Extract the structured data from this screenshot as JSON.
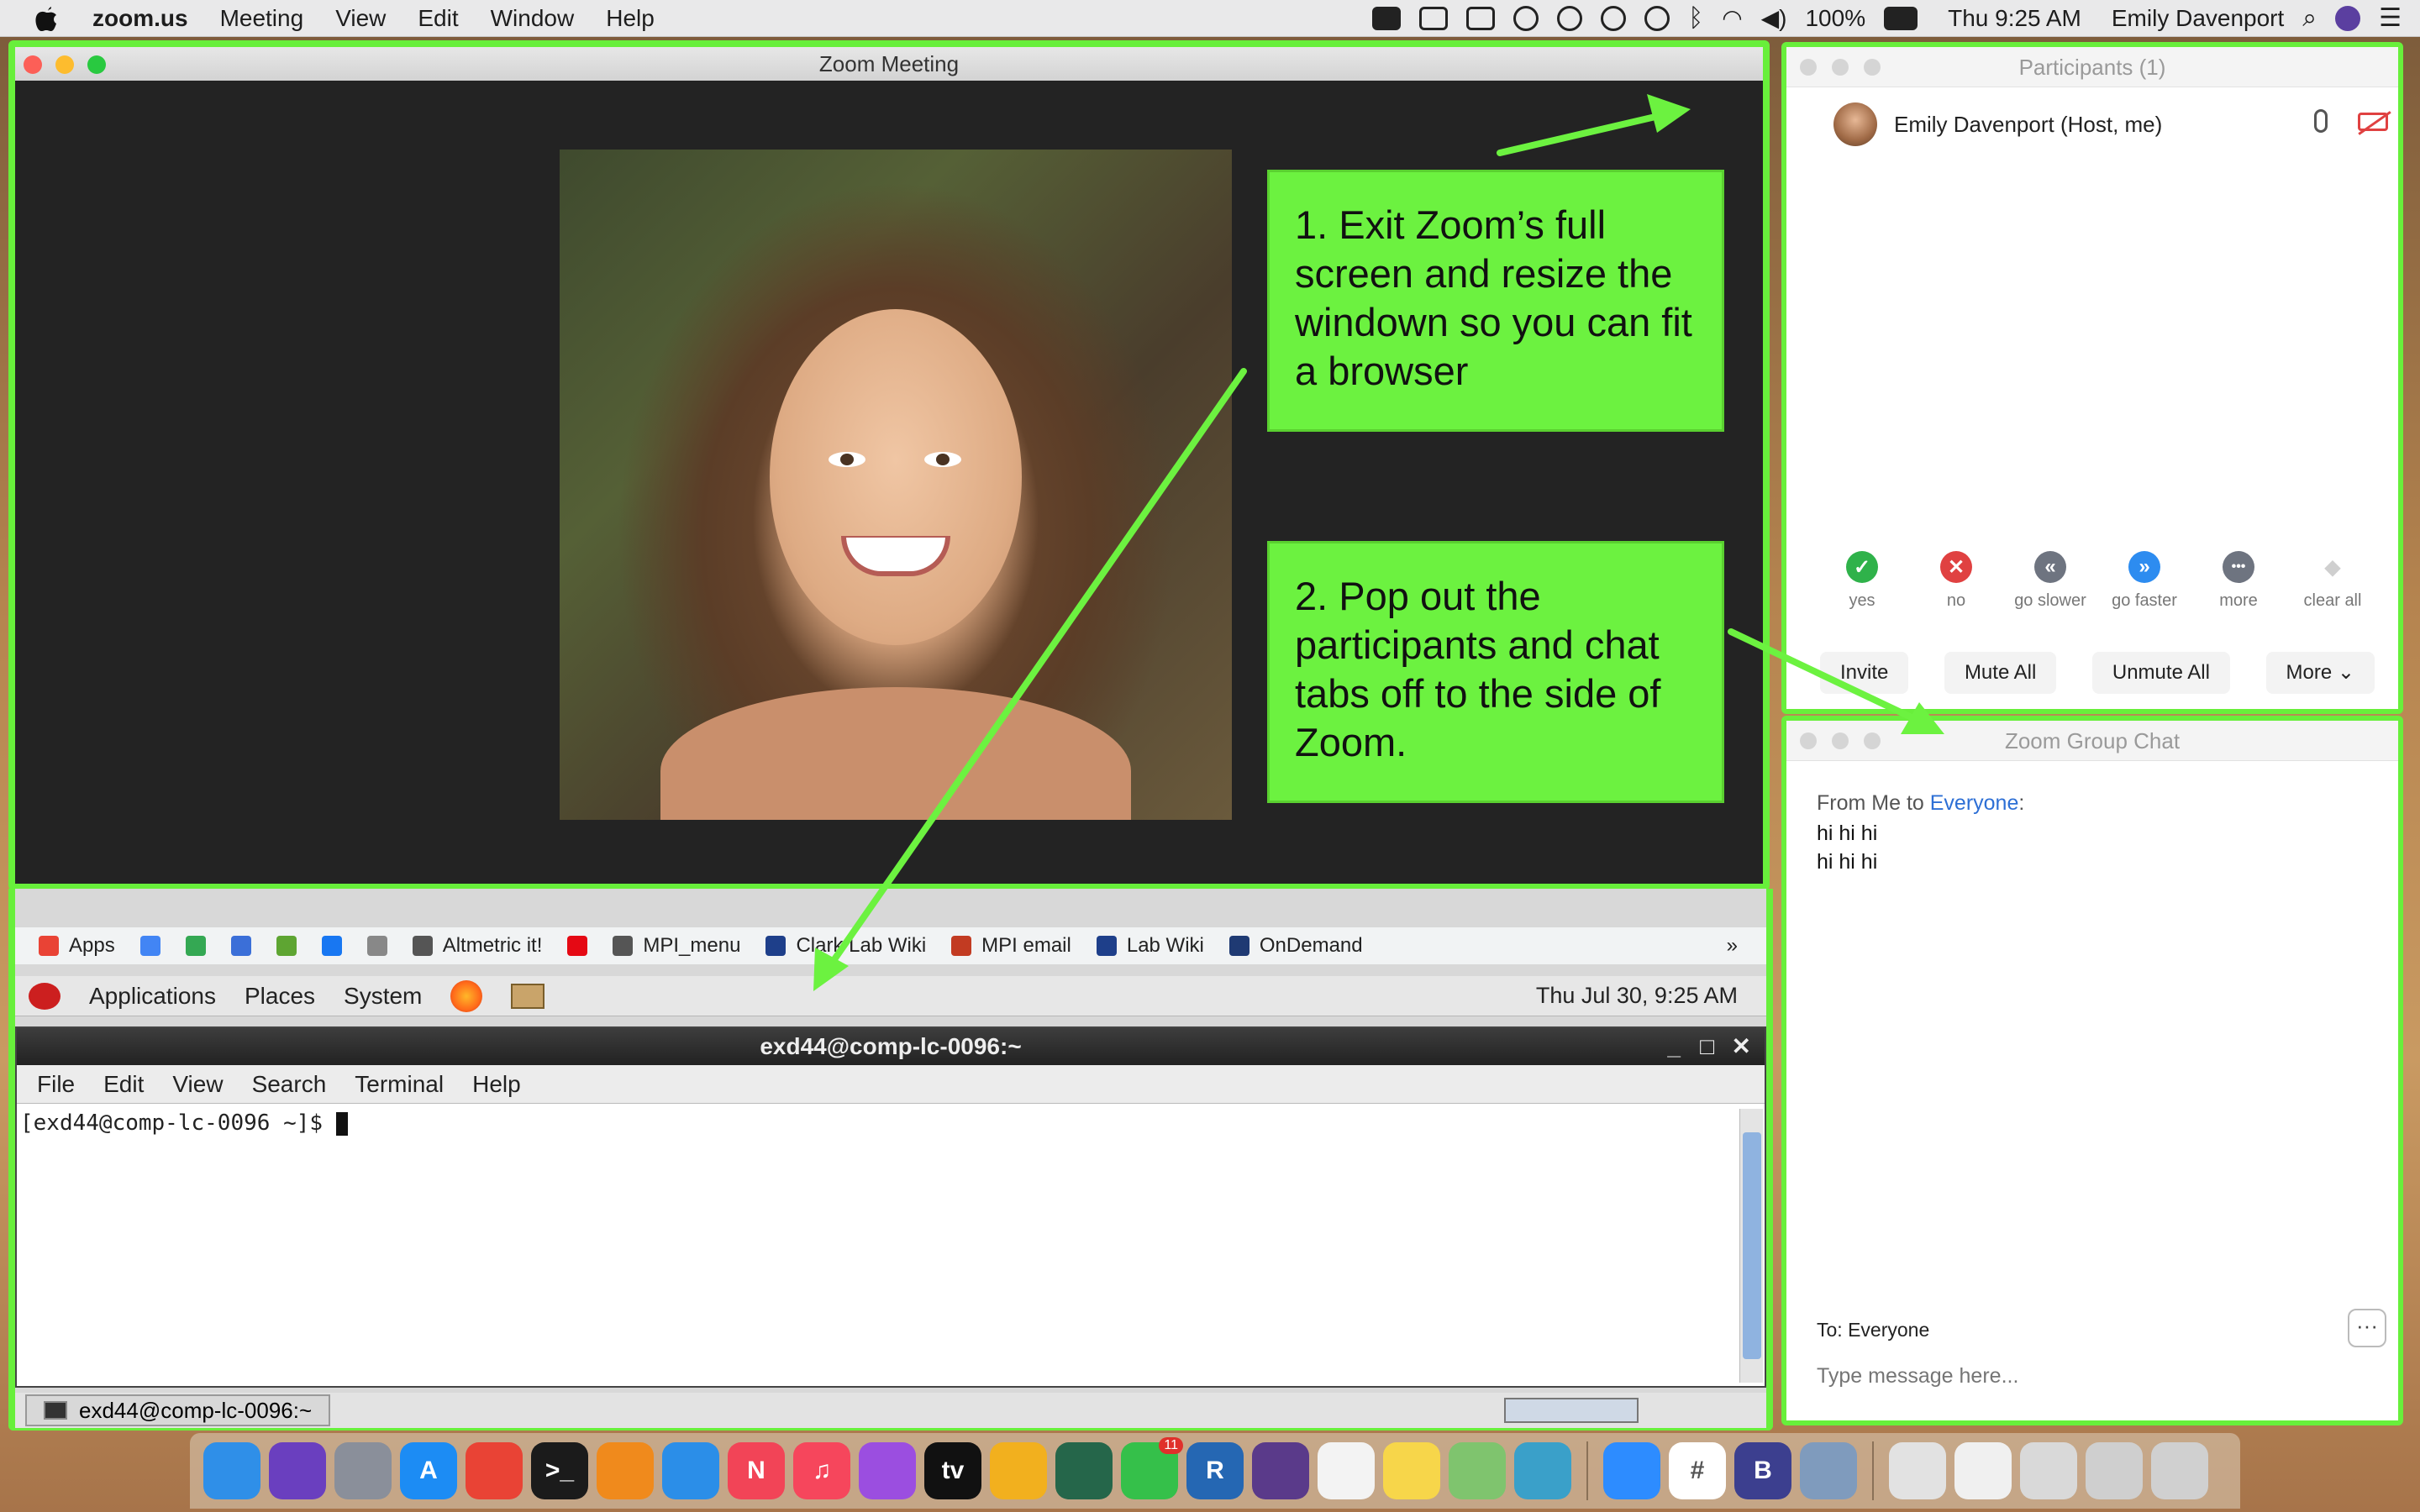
{
  "menubar": {
    "app_name": "zoom.us",
    "menus": [
      "Meeting",
      "View",
      "Edit",
      "Window",
      "Help"
    ],
    "battery": "100%",
    "clock": "Thu 9:25 AM",
    "user": "Emily Davenport"
  },
  "zoom": {
    "window_title": "Zoom Meeting",
    "note1": "1. Exit Zoom’s full screen and resize the windown so you can fit a browser",
    "note2": "2. Pop out the participants and chat tabs off to the side of Zoom."
  },
  "participants": {
    "title": "Participants (1)",
    "name": "Emily Davenport (Host, me)",
    "reactions": [
      {
        "label": "yes",
        "color": "#2fb24a",
        "glyph": "✓"
      },
      {
        "label": "no",
        "color": "#e04141",
        "glyph": "✕"
      },
      {
        "label": "go slower",
        "color": "#6e7480",
        "glyph": "«"
      },
      {
        "label": "go faster",
        "color": "#2d8cf0",
        "glyph": "»"
      },
      {
        "label": "more",
        "color": "#6e7480",
        "glyph": "•••"
      },
      {
        "label": "clear all",
        "color": "#cfcfcf",
        "glyph": "◆"
      }
    ],
    "actions": {
      "invite": "Invite",
      "mute_all": "Mute All",
      "unmute_all": "Unmute All",
      "more": "More ⌄"
    }
  },
  "chat": {
    "title": "Zoom Group Chat",
    "from_prefix": "From Me to ",
    "from_to": "Everyone",
    "from_suffix": ":",
    "messages": [
      "hi hi hi",
      "hi hi hi"
    ],
    "to_label": "To: Everyone",
    "more": "···",
    "input_placeholder": "Type message here..."
  },
  "remote": {
    "bookmarks": [
      {
        "label": "Apps",
        "icon": "apps-grid-icon",
        "color": "#e94335"
      },
      {
        "label": "",
        "icon": "google-icon",
        "color": "#4285f4"
      },
      {
        "label": "",
        "icon": "maps-pin-icon",
        "color": "#34a853"
      },
      {
        "label": "",
        "icon": "bookmark-diamond-icon",
        "color": "#3b6fd8"
      },
      {
        "label": "",
        "icon": "houzz-icon",
        "color": "#5ea532"
      },
      {
        "label": "",
        "icon": "facebook-icon",
        "color": "#1877f2"
      },
      {
        "label": "",
        "icon": "p-icon",
        "color": "#888888"
      },
      {
        "label": "Altmetric it!",
        "icon": "globe-icon",
        "color": "#555555"
      },
      {
        "label": "",
        "icon": "netflix-icon",
        "color": "#e50914"
      },
      {
        "label": "MPI_menu",
        "icon": "globe-icon",
        "color": "#555555"
      },
      {
        "label": "Clark Lab Wiki",
        "icon": "wiki-icon",
        "color": "#1e3f8a"
      },
      {
        "label": "MPI email",
        "icon": "mail-icon",
        "color": "#c23b22"
      },
      {
        "label": "Lab Wiki",
        "icon": "wiki-icon",
        "color": "#1e3f8a"
      },
      {
        "label": "OnDemand",
        "icon": "shield-icon",
        "color": "#1f3a73"
      }
    ],
    "bookmarks_overflow": "»",
    "gnome_menus": [
      "Applications",
      "Places",
      "System"
    ],
    "gnome_time": "Thu Jul 30,  9:25 AM",
    "terminal_title": "exd44@comp-lc-0096:~",
    "terminal_menus": [
      "File",
      "Edit",
      "View",
      "Search",
      "Terminal",
      "Help"
    ],
    "prompt": "[exd44@comp-lc-0096 ~]$ ",
    "taskbar_item": "exd44@comp-lc-0096:~"
  },
  "dock": {
    "apps": [
      {
        "name": "finder-icon",
        "color": "#2f8fe8",
        "glyph": ""
      },
      {
        "name": "siri-icon",
        "color": "#6a3fbf",
        "glyph": ""
      },
      {
        "name": "launchpad-icon",
        "color": "#8a8f9a",
        "glyph": ""
      },
      {
        "name": "app-store-icon",
        "color": "#1c8cf4",
        "glyph": "A"
      },
      {
        "name": "chrome-icon",
        "color": "#e94335",
        "glyph": ""
      },
      {
        "name": "terminal-icon",
        "color": "#1b1b1b",
        "glyph": ">_"
      },
      {
        "name": "books-icon",
        "color": "#f08a1c",
        "glyph": ""
      },
      {
        "name": "safari-icon",
        "color": "#2b8ee8",
        "glyph": ""
      },
      {
        "name": "news-icon",
        "color": "#f24457",
        "glyph": "N"
      },
      {
        "name": "music-icon",
        "color": "#f6465c",
        "glyph": "♫"
      },
      {
        "name": "podcasts-icon",
        "color": "#9b4ee0",
        "glyph": ""
      },
      {
        "name": "apple-tv-icon",
        "color": "#111111",
        "glyph": "tv"
      },
      {
        "name": "photos-icon",
        "color": "#f2b01e",
        "glyph": ""
      },
      {
        "name": "time-machine-icon",
        "color": "#25664a",
        "glyph": ""
      },
      {
        "name": "facetime-icon",
        "color": "#35c04a",
        "glyph": ""
      },
      {
        "name": "r-icon",
        "color": "#2567b3",
        "glyph": "R"
      },
      {
        "name": "photo-booth-icon",
        "color": "#5a3a8a",
        "glyph": ""
      },
      {
        "name": "reminders-icon",
        "color": "#f3f3f3",
        "glyph": ""
      },
      {
        "name": "notes-icon",
        "color": "#f7d64a",
        "glyph": ""
      },
      {
        "name": "maps-icon",
        "color": "#7fc46e",
        "glyph": ""
      },
      {
        "name": "network-icon",
        "color": "#3aa0c9",
        "glyph": ""
      },
      {
        "name": "zoom-icon",
        "color": "#2d8cff",
        "glyph": ""
      },
      {
        "name": "slack-icon",
        "color": "#ffffff",
        "glyph": "#"
      },
      {
        "name": "bbedit-icon",
        "color": "#3c3f8f",
        "glyph": "B"
      },
      {
        "name": "preview-icon",
        "color": "#7f9bbd",
        "glyph": ""
      },
      {
        "name": "archive-icon",
        "color": "#e2e2e2",
        "glyph": ""
      },
      {
        "name": "folder-icon",
        "color": "#f0f0f0",
        "glyph": ""
      },
      {
        "name": "screenshot-icon",
        "color": "#d9d9d9",
        "glyph": ""
      },
      {
        "name": "window-icon",
        "color": "#cfcfcf",
        "glyph": ""
      },
      {
        "name": "trash-icon",
        "color": "#d0d0d0",
        "glyph": ""
      }
    ],
    "facetime_badge": "11"
  },
  "colors": {
    "highlight": "#68ef3b",
    "note_bg": "#6cf240"
  }
}
